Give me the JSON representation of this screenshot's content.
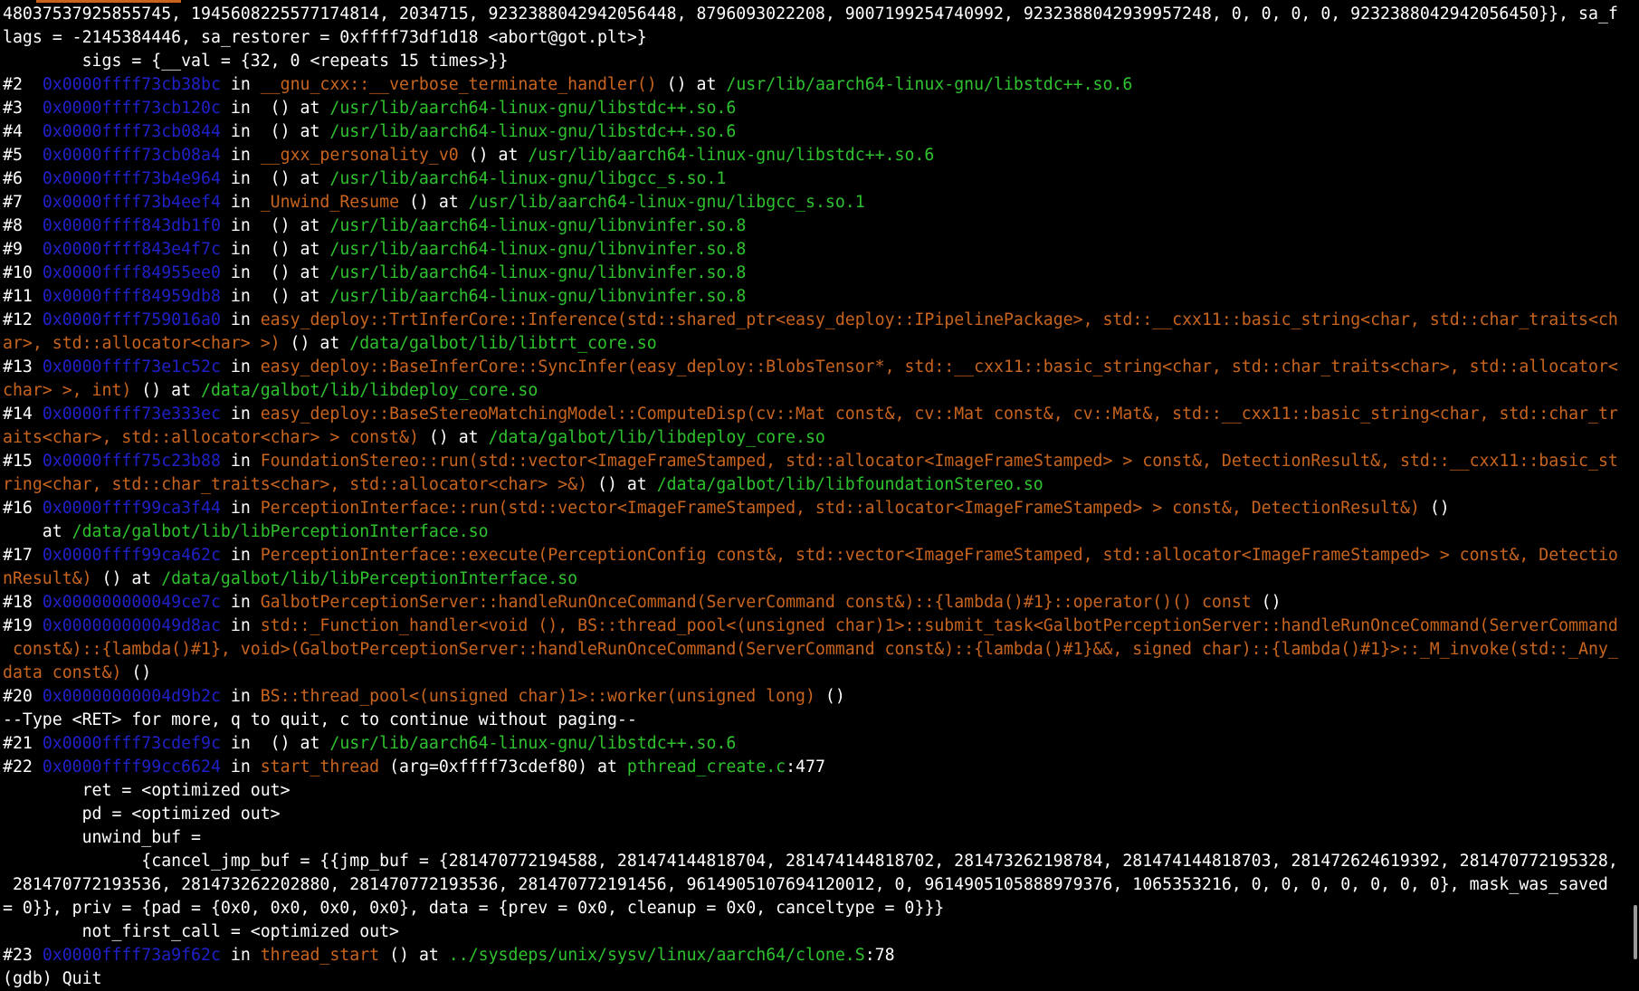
{
  "colors": {
    "background": "#000000",
    "text": "#ffffff",
    "address": "#2020c8",
    "function": "#c8641e",
    "file": "#2ec22e"
  },
  "lines": [
    [
      {
        "t": "48037537925855745, 1945608225577174814, 2034715, 9232388042942056448, 8796093022208, 9007199254740992, 9232388042939957248, 0, 0, 0, 0, 9232388042942056450}}, sa_f"
      }
    ],
    [
      {
        "t": "lags = -2145384446, sa_restorer = 0xffff73df1d18 <abort@got.plt>}"
      }
    ],
    [
      {
        "t": "        sigs = {__val = {32, 0 <repeats 15 times>}}"
      }
    ],
    [
      {
        "t": "#2  "
      },
      {
        "t": "0x0000ffff73cb38bc",
        "c": "addr"
      },
      {
        "t": " in "
      },
      {
        "t": "__gnu_cxx::__verbose_terminate_handler()",
        "c": "func"
      },
      {
        "t": " () at "
      },
      {
        "t": "/usr/lib/aarch64-linux-gnu/libstdc++.so.6",
        "c": "file"
      }
    ],
    [
      {
        "t": "#3  "
      },
      {
        "t": "0x0000ffff73cb120c",
        "c": "addr"
      },
      {
        "t": " in  () at "
      },
      {
        "t": "/usr/lib/aarch64-linux-gnu/libstdc++.so.6",
        "c": "file"
      }
    ],
    [
      {
        "t": "#4  "
      },
      {
        "t": "0x0000ffff73cb0844",
        "c": "addr"
      },
      {
        "t": " in  () at "
      },
      {
        "t": "/usr/lib/aarch64-linux-gnu/libstdc++.so.6",
        "c": "file"
      }
    ],
    [
      {
        "t": "#5  "
      },
      {
        "t": "0x0000ffff73cb08a4",
        "c": "addr"
      },
      {
        "t": " in "
      },
      {
        "t": "__gxx_personality_v0",
        "c": "func"
      },
      {
        "t": " () at "
      },
      {
        "t": "/usr/lib/aarch64-linux-gnu/libstdc++.so.6",
        "c": "file"
      }
    ],
    [
      {
        "t": "#6  "
      },
      {
        "t": "0x0000ffff73b4e964",
        "c": "addr"
      },
      {
        "t": " in  () at "
      },
      {
        "t": "/usr/lib/aarch64-linux-gnu/libgcc_s.so.1",
        "c": "file"
      }
    ],
    [
      {
        "t": "#7  "
      },
      {
        "t": "0x0000ffff73b4eef4",
        "c": "addr"
      },
      {
        "t": " in "
      },
      {
        "t": "_Unwind_Resume",
        "c": "func"
      },
      {
        "t": " () at "
      },
      {
        "t": "/usr/lib/aarch64-linux-gnu/libgcc_s.so.1",
        "c": "file"
      }
    ],
    [
      {
        "t": "#8  "
      },
      {
        "t": "0x0000ffff843db1f0",
        "c": "addr"
      },
      {
        "t": " in  () at "
      },
      {
        "t": "/usr/lib/aarch64-linux-gnu/libnvinfer.so.8",
        "c": "file"
      }
    ],
    [
      {
        "t": "#9  "
      },
      {
        "t": "0x0000ffff843e4f7c",
        "c": "addr"
      },
      {
        "t": " in  () at "
      },
      {
        "t": "/usr/lib/aarch64-linux-gnu/libnvinfer.so.8",
        "c": "file"
      }
    ],
    [
      {
        "t": "#10 "
      },
      {
        "t": "0x0000ffff84955ee0",
        "c": "addr"
      },
      {
        "t": " in  () at "
      },
      {
        "t": "/usr/lib/aarch64-linux-gnu/libnvinfer.so.8",
        "c": "file"
      }
    ],
    [
      {
        "t": "#11 "
      },
      {
        "t": "0x0000ffff84959db8",
        "c": "addr"
      },
      {
        "t": " in  () at "
      },
      {
        "t": "/usr/lib/aarch64-linux-gnu/libnvinfer.so.8",
        "c": "file"
      }
    ],
    [
      {
        "t": "#12 "
      },
      {
        "t": "0x0000ffff759016a0",
        "c": "addr"
      },
      {
        "t": " in "
      },
      {
        "t": "easy_deploy::TrtInferCore::Inference(std::shared_ptr<easy_deploy::IPipelinePackage>, std::__cxx11::basic_string<char, std::char_traits<ch",
        "c": "func"
      }
    ],
    [
      {
        "t": "ar>, std::allocator<char> >)",
        "c": "func"
      },
      {
        "t": " () at "
      },
      {
        "t": "/data/galbot/lib/libtrt_core.so",
        "c": "file"
      }
    ],
    [
      {
        "t": "#13 "
      },
      {
        "t": "0x0000ffff73e1c52c",
        "c": "addr"
      },
      {
        "t": " in "
      },
      {
        "t": "easy_deploy::BaseInferCore::SyncInfer(easy_deploy::BlobsTensor*, std::__cxx11::basic_string<char, std::char_traits<char>, std::allocator<",
        "c": "func"
      }
    ],
    [
      {
        "t": "char> >, int)",
        "c": "func"
      },
      {
        "t": " () at "
      },
      {
        "t": "/data/galbot/lib/libdeploy_core.so",
        "c": "file"
      }
    ],
    [
      {
        "t": "#14 "
      },
      {
        "t": "0x0000ffff73e333ec",
        "c": "addr"
      },
      {
        "t": " in "
      },
      {
        "t": "easy_deploy::BaseStereoMatchingModel::ComputeDisp(cv::Mat const&, cv::Mat const&, cv::Mat&, std::__cxx11::basic_string<char, std::char_tr",
        "c": "func"
      }
    ],
    [
      {
        "t": "aits<char>, std::allocator<char> > const&)",
        "c": "func"
      },
      {
        "t": " () at "
      },
      {
        "t": "/data/galbot/lib/libdeploy_core.so",
        "c": "file"
      }
    ],
    [
      {
        "t": "#15 "
      },
      {
        "t": "0x0000ffff75c23b88",
        "c": "addr"
      },
      {
        "t": " in "
      },
      {
        "t": "FoundationStereo::run(std::vector<ImageFrameStamped, std::allocator<ImageFrameStamped> > const&, DetectionResult&, std::__cxx11::basic_st",
        "c": "func"
      }
    ],
    [
      {
        "t": "ring<char, std::char_traits<char>, std::allocator<char> >&)",
        "c": "func"
      },
      {
        "t": " () at "
      },
      {
        "t": "/data/galbot/lib/libfoundationStereo.so",
        "c": "file"
      }
    ],
    [
      {
        "t": "#16 "
      },
      {
        "t": "0x0000ffff99ca3f44",
        "c": "addr"
      },
      {
        "t": " in "
      },
      {
        "t": "PerceptionInterface::run(std::vector<ImageFrameStamped, std::allocator<ImageFrameStamped> > const&, DetectionResult&)",
        "c": "func"
      },
      {
        "t": " ()"
      }
    ],
    [
      {
        "t": "    at "
      },
      {
        "t": "/data/galbot/lib/libPerceptionInterface.so",
        "c": "file"
      }
    ],
    [
      {
        "t": "#17 "
      },
      {
        "t": "0x0000ffff99ca462c",
        "c": "addr"
      },
      {
        "t": " in "
      },
      {
        "t": "PerceptionInterface::execute(PerceptionConfig const&, std::vector<ImageFrameStamped, std::allocator<ImageFrameStamped> > const&, Detectio",
        "c": "func"
      }
    ],
    [
      {
        "t": "nResult&)",
        "c": "func"
      },
      {
        "t": " () at "
      },
      {
        "t": "/data/galbot/lib/libPerceptionInterface.so",
        "c": "file"
      }
    ],
    [
      {
        "t": "#18 "
      },
      {
        "t": "0x000000000049ce7c",
        "c": "addr"
      },
      {
        "t": " in "
      },
      {
        "t": "GalbotPerceptionServer::handleRunOnceCommand(ServerCommand const&)::{lambda()#1}::operator()() const",
        "c": "func"
      },
      {
        "t": " ()"
      }
    ],
    [
      {
        "t": "#19 "
      },
      {
        "t": "0x000000000049d8ac",
        "c": "addr"
      },
      {
        "t": " in "
      },
      {
        "t": "std::_Function_handler<void (), BS::thread_pool<(unsigned char)1>::submit_task<GalbotPerceptionServer::handleRunOnceCommand(ServerCommand",
        "c": "func"
      }
    ],
    [
      {
        "t": " const&)::{lambda()#1}, void>(GalbotPerceptionServer::handleRunOnceCommand(ServerCommand const&)::{lambda()#1}&&, signed char)::{lambda()#1}>::_M_invoke(std::_Any_",
        "c": "func"
      }
    ],
    [
      {
        "t": "data const&)",
        "c": "func"
      },
      {
        "t": " ()"
      }
    ],
    [
      {
        "t": "#20 "
      },
      {
        "t": "0x00000000004d9b2c",
        "c": "addr"
      },
      {
        "t": " in "
      },
      {
        "t": "BS::thread_pool<(unsigned char)1>::worker(unsigned long)",
        "c": "func"
      },
      {
        "t": " ()"
      }
    ],
    [
      {
        "t": "--Type <RET> for more, q to quit, c to continue without paging--"
      }
    ],
    [
      {
        "t": "#21 "
      },
      {
        "t": "0x0000ffff73cdef9c",
        "c": "addr"
      },
      {
        "t": " in  () at "
      },
      {
        "t": "/usr/lib/aarch64-linux-gnu/libstdc++.so.6",
        "c": "file"
      }
    ],
    [
      {
        "t": "#22 "
      },
      {
        "t": "0x0000ffff99cc6624",
        "c": "addr"
      },
      {
        "t": " in "
      },
      {
        "t": "start_thread",
        "c": "func"
      },
      {
        "t": " (arg=0xffff73cdef80) at "
      },
      {
        "t": "pthread_create.c",
        "c": "file"
      },
      {
        "t": ":477"
      }
    ],
    [
      {
        "t": "        ret = <optimized out>"
      }
    ],
    [
      {
        "t": "        pd = <optimized out>"
      }
    ],
    [
      {
        "t": "        unwind_buf = "
      }
    ],
    [
      {
        "t": "              {cancel_jmp_buf = {{jmp_buf = {281470772194588, 281474144818704, 281474144818702, 281473262198784, 281474144818703, 281472624619392, 281470772195328,"
      }
    ],
    [
      {
        "t": " 281470772193536, 281473262202880, 281470772193536, 281470772191456, 9614905107694120012, 0, 9614905105888979376, 1065353216, 0, 0, 0, 0, 0, 0, 0}, mask_was_saved"
      }
    ],
    [
      {
        "t": "= 0}}, priv = {pad = {0x0, 0x0, 0x0, 0x0}, data = {prev = 0x0, cleanup = 0x0, canceltype = 0}}}"
      }
    ],
    [
      {
        "t": "        not_first_call = <optimized out>"
      }
    ],
    [
      {
        "t": "#23 "
      },
      {
        "t": "0x0000ffff73a9f62c",
        "c": "addr"
      },
      {
        "t": " in "
      },
      {
        "t": "thread_start",
        "c": "func"
      },
      {
        "t": " () at "
      },
      {
        "t": "../sysdeps/unix/sysv/linux/aarch64/clone.S",
        "c": "file"
      },
      {
        "t": ":78"
      }
    ],
    [
      {
        "t": "(gdb) Quit"
      }
    ]
  ]
}
